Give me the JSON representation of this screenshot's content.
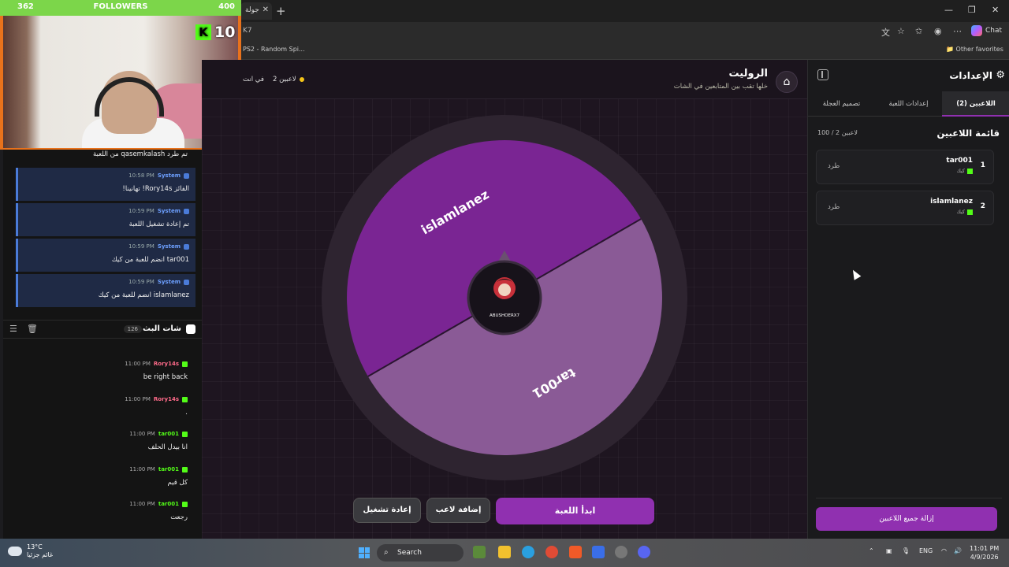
{
  "browser": {
    "tab_title": "جولة",
    "url_tail": "K7",
    "bookmark": "PS2 - Random Spi...",
    "other_favorites": "Other favorites",
    "copilot": "Chat"
  },
  "stream_overlay": {
    "followers_current": "362",
    "followers_label": "FOLLOWERS",
    "followers_goal": "400",
    "kick_count": "10"
  },
  "chat_panel": {
    "first_message": "تم طرد qasemkalash من اللعبة",
    "system_messages": [
      {
        "time": "10:58 PM",
        "author": "System",
        "text": "الفائز Rory14s! تهانينا!"
      },
      {
        "time": "10:59 PM",
        "author": "System",
        "text": "تم إعادة تشغيل اللعبة"
      },
      {
        "time": "10:59 PM",
        "author": "System",
        "text": "tar001 انضم للعبة من كيك"
      },
      {
        "time": "10:59 PM",
        "author": "System",
        "text": "islamlanez انضم للعبة من كيك"
      }
    ],
    "chat_title": "شات البث",
    "chat_count": "126",
    "messages": [
      {
        "time": "11:00 PM",
        "author": "Rory14s",
        "color": "#ff6b8a",
        "text": "be right back"
      },
      {
        "time": "11:00 PM",
        "author": "Rory14s",
        "color": "#ff6b8a",
        "text": "."
      },
      {
        "time": "11:00 PM",
        "author": "tar001",
        "color": "#53fc18",
        "text": "انا بيدل الحلف"
      },
      {
        "time": "11:00 PM",
        "author": "tar001",
        "color": "#53fc18",
        "text": "كل قيم"
      },
      {
        "time": "11:00 PM",
        "author": "tar001",
        "color": "#53fc18",
        "text": "رجعت"
      }
    ]
  },
  "game": {
    "title": "الروليت",
    "subtitle": "خلها تقب بين المتابعين في الشات",
    "players_status": "2 لاعبين",
    "extra_status": "في انت",
    "wheel": {
      "segments": [
        {
          "name": "islamlanez",
          "color": "#7a2593"
        },
        {
          "name": "tar001",
          "color": "#8a5a96"
        }
      ],
      "center_logo_text": "ABUSHOERX7"
    },
    "buttons": {
      "start": "ابدأ اللعبة",
      "add_player": "إضافة لاعب",
      "restart": "إعادة تشغيل"
    }
  },
  "settings": {
    "title": "الإعدادات",
    "tabs": [
      "اللاعبين (2)",
      "إعدادات اللعبة",
      "تصميم العجلة"
    ],
    "players_list_title": "قائمة اللاعبين",
    "players_count": "100 / 2 لاعبين",
    "players": [
      {
        "index": "1",
        "name": "tar001",
        "source": "كيك",
        "kick_label": "طرد"
      },
      {
        "index": "2",
        "name": "islamlanez",
        "source": "كيك",
        "kick_label": "طرد"
      }
    ],
    "remove_all": "إزالة جميع اللاعبين"
  },
  "taskbar": {
    "temp": "13°C",
    "weather_text": "غائم جزئيا",
    "search": "Search",
    "lang": "ENG",
    "time": "11:01 PM",
    "date": "4/9/2026"
  }
}
